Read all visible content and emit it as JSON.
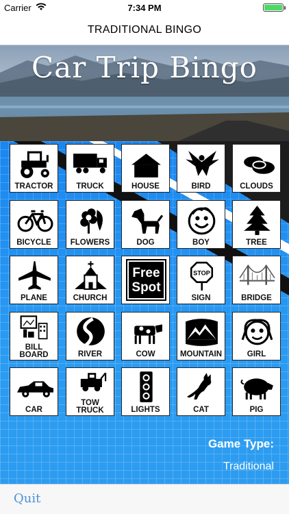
{
  "status_bar": {
    "carrier": "Carrier",
    "time": "7:34 PM"
  },
  "nav": {
    "title": "TRADITIONAL BINGO"
  },
  "banner": {
    "title": "Car Trip Bingo"
  },
  "tiles": [
    {
      "label": "TRACTOR",
      "icon": "tractor-icon"
    },
    {
      "label": "TRUCK",
      "icon": "truck-icon"
    },
    {
      "label": "HOUSE",
      "icon": "house-icon"
    },
    {
      "label": "BIRD",
      "icon": "bird-icon"
    },
    {
      "label": "CLOUDS",
      "icon": "clouds-icon"
    },
    {
      "label": "BICYCLE",
      "icon": "bicycle-icon"
    },
    {
      "label": "FLOWERS",
      "icon": "flower-icon"
    },
    {
      "label": "DOG",
      "icon": "dog-icon"
    },
    {
      "label": "BOY",
      "icon": "boy-face-icon"
    },
    {
      "label": "TREE",
      "icon": "tree-icon"
    },
    {
      "label": "PLANE",
      "icon": "plane-icon"
    },
    {
      "label": "CHURCH",
      "icon": "church-icon"
    },
    {
      "label": "Free Spot",
      "icon": "free-spot"
    },
    {
      "label": "SIGN",
      "icon": "stop-sign-icon"
    },
    {
      "label": "BRIDGE",
      "icon": "bridge-icon"
    },
    {
      "label_line1": "BILL",
      "label_line2": "BOARD",
      "icon": "billboard-icon"
    },
    {
      "label": "RIVER",
      "icon": "river-icon"
    },
    {
      "label": "COW",
      "icon": "cow-icon"
    },
    {
      "label": "MOUNTAIN",
      "icon": "mountain-icon"
    },
    {
      "label": "GIRL",
      "icon": "girl-face-icon"
    },
    {
      "label": "CAR",
      "icon": "car-icon"
    },
    {
      "label_line1": "TOW",
      "label_line2": "TRUCK",
      "icon": "tow-truck-icon"
    },
    {
      "label": "LIGHTS",
      "icon": "traffic-light-icon"
    },
    {
      "label": "CAT",
      "icon": "cat-icon"
    },
    {
      "label": "PIG",
      "icon": "pig-icon"
    }
  ],
  "game_type": {
    "label": "Game Type:",
    "value": "Traditional"
  },
  "toolbar": {
    "quit_label": "Quit"
  },
  "colors": {
    "board_blue": "#1e8ff0",
    "quit_blue": "#4a90d9",
    "battery_green": "#4cd964"
  }
}
